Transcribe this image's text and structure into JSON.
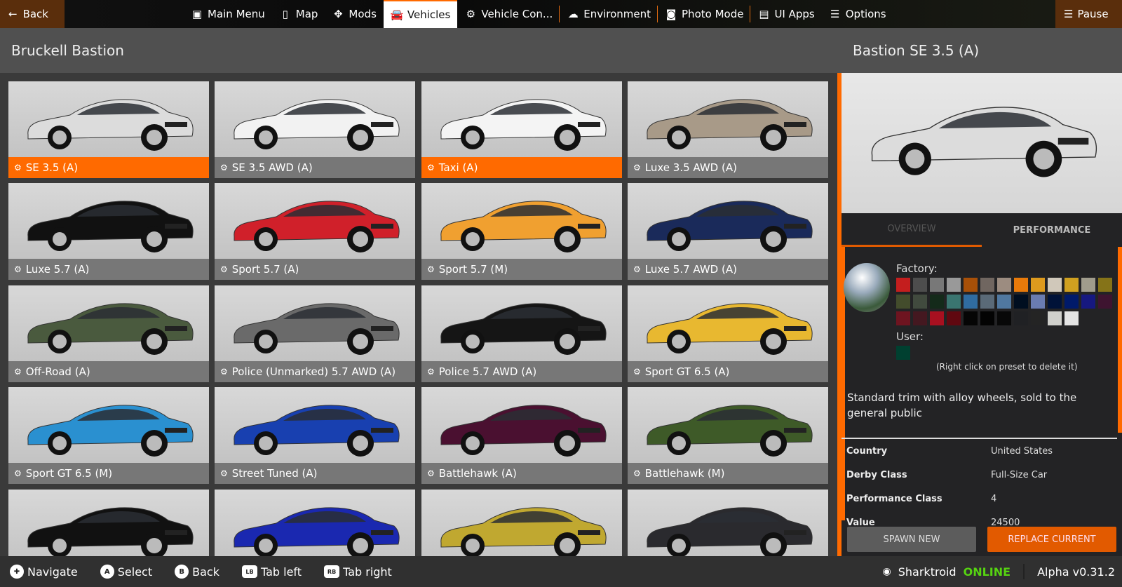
{
  "topbar": {
    "back": "Back",
    "pause": "Pause",
    "items": [
      {
        "label": "Main Menu",
        "icon": "main-menu-icon",
        "glyph": "▣"
      },
      {
        "label": "Map",
        "icon": "map-icon",
        "glyph": "▯"
      },
      {
        "label": "Mods",
        "icon": "puzzle-icon",
        "glyph": "✥"
      },
      {
        "label": "Vehicles",
        "icon": "car-icon",
        "glyph": "🚘",
        "active": true
      },
      {
        "label": "Vehicle Con...",
        "icon": "engine-icon",
        "glyph": "⚙"
      },
      {
        "label": "Environment",
        "icon": "weather-icon",
        "glyph": "☁"
      },
      {
        "label": "Photo Mode",
        "icon": "camera-icon",
        "glyph": "◙"
      },
      {
        "label": "UI Apps",
        "icon": "ui-apps-icon",
        "glyph": "▤"
      },
      {
        "label": "Options",
        "icon": "sliders-icon",
        "glyph": "☰"
      }
    ]
  },
  "left": {
    "title": "Bruckell Bastion"
  },
  "vehicles": [
    {
      "label": "SE 3.5 (A)",
      "color": "#dcdcdc",
      "selected": true
    },
    {
      "label": "SE 3.5 AWD (A)",
      "color": "#f2f2f2"
    },
    {
      "label": "Taxi (A)",
      "color": "#f4f4f4",
      "selected": true
    },
    {
      "label": "Luxe 3.5 AWD (A)",
      "color": "#a89a88"
    },
    {
      "label": "Luxe 5.7 (A)",
      "color": "#111111"
    },
    {
      "label": "Sport 5.7 (A)",
      "color": "#d0202a"
    },
    {
      "label": "Sport 5.7 (M)",
      "color": "#f0a030"
    },
    {
      "label": "Luxe 5.7 AWD (A)",
      "color": "#1a2a5a"
    },
    {
      "label": "Off-Road (A)",
      "color": "#4a5a3e"
    },
    {
      "label": "Police (Unmarked) 5.7 AWD (A)",
      "color": "#6a6a6a"
    },
    {
      "label": "Police 5.7 AWD (A)",
      "color": "#151515"
    },
    {
      "label": "Sport GT 6.5 (A)",
      "color": "#e8b830"
    },
    {
      "label": "Sport GT 6.5 (M)",
      "color": "#2a90d0"
    },
    {
      "label": "Street Tuned (A)",
      "color": "#1840b0"
    },
    {
      "label": "Battlehawk (A)",
      "color": "#4a1030"
    },
    {
      "label": "Battlehawk (M)",
      "color": "#3e5a28"
    },
    {
      "label": "",
      "color": "#111111"
    },
    {
      "label": "",
      "color": "#1a28b0"
    },
    {
      "label": "",
      "color": "#c0a830"
    },
    {
      "label": "",
      "color": "#2a2a2e"
    }
  ],
  "right": {
    "title": "Bastion SE 3.5 (A)",
    "car_color": "#dcdcdc",
    "tabs": [
      "OVERVIEW",
      "PERFORMANCE"
    ],
    "factory_label": "Factory:",
    "user_label": "User:",
    "factory_colors": [
      "#c41e1e",
      "#4d4d4d",
      "#787878",
      "#999999",
      "#a85008",
      "#706660",
      "#9c8c80",
      "#e87a0a",
      "#dd9a1e",
      "#d0c8ba",
      "#cfa020",
      "#a09c8c",
      "#857318",
      "#434c2c",
      "#414a3e",
      "#142a1a",
      "#3a7570",
      "#306ca0",
      "#5a6a78",
      "#5078a0",
      "#000e20",
      "#6a7cb0",
      "#001238",
      "#001a6a",
      "#161880",
      "#3e1430",
      "#6e1420",
      "#441820",
      "#a81020",
      "#600810",
      "#050505",
      "#030303",
      "#080808",
      "#202124",
      "#242424",
      "#d0d0cc",
      "#e4e4e4"
    ],
    "user_colors": [
      "#004030"
    ],
    "hint": "(Right click on preset to delete it)",
    "description": "Standard trim with alloy wheels, sold to the general public",
    "stats": [
      {
        "k": "Country",
        "v": "United States"
      },
      {
        "k": "Derby Class",
        "v": "Full-Size Car"
      },
      {
        "k": "Performance Class",
        "v": "4"
      },
      {
        "k": "Value",
        "v": "24500"
      }
    ],
    "spawn": "SPAWN NEW",
    "replace": "REPLACE CURRENT"
  },
  "bottom": {
    "hints": [
      {
        "key": "✚",
        "label": "Navigate"
      },
      {
        "key": "A",
        "label": "Select"
      },
      {
        "key": "B",
        "label": "Back"
      },
      {
        "key": "LB",
        "label": "Tab left"
      },
      {
        "key": "RB",
        "label": "Tab right"
      }
    ],
    "user": "Sharktroid",
    "online": "ONLINE",
    "version": "Alpha v0.31.2"
  },
  "colors": {
    "accent": "#ff6a00",
    "online": "#56d411"
  }
}
